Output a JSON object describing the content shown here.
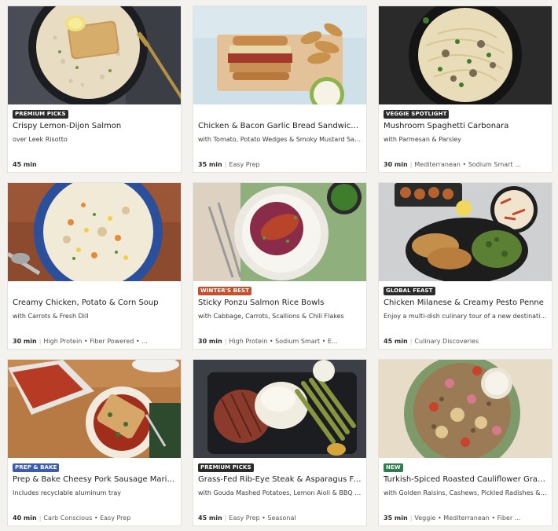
{
  "menu": {
    "cards": [
      {
        "badge": "PREMIUM PICKS",
        "badge_color": "#2b2b2b",
        "title": "Crispy Lemon-Dijon Salmon",
        "subtitle": "over Leek Risotto",
        "time": "45 min",
        "tags": ""
      },
      {
        "badge": "",
        "badge_color": "",
        "title": "Chicken & Bacon Garlic Bread Sandwiches",
        "subtitle": "with Tomato, Potato Wedges & Smoky Mustard Sauce",
        "time": "35 min",
        "tags": "Easy Prep"
      },
      {
        "badge": "VEGGIE SPOTLIGHT",
        "badge_color": "#2b2b2b",
        "title": "Mushroom Spaghetti Carbonara",
        "subtitle": "with Parmesan & Parsley",
        "time": "30 min",
        "tags": "Mediterranean • Sodium Smart ..."
      },
      {
        "badge": "",
        "badge_color": "",
        "title": "Creamy Chicken, Potato & Corn Soup",
        "subtitle": "with Carrots & Fresh Dill",
        "time": "30 min",
        "tags": "High Protein • Fiber Powered • ..."
      },
      {
        "badge": "WINTER'S BEST",
        "badge_color": "#c2522d",
        "title": "Sticky Ponzu Salmon Rice Bowls",
        "subtitle": "with Cabbage, Carrots, Scallions & Chili Flakes",
        "time": "30 min",
        "tags": "High Protein • Sodium Smart • E..."
      },
      {
        "badge": "GLOBAL FEAST",
        "badge_color": "#2b2b2b",
        "title": "Chicken Milanese & Creamy Pesto Penne",
        "subtitle": "Enjoy a multi-dish culinary tour of a new destination!",
        "time": "45 min",
        "tags": "Culinary Discoveries"
      },
      {
        "badge": "PREP & BAKE",
        "badge_color": "#3a5bb0",
        "title": "Prep & Bake Cheesy Pork Sausage Marinara",
        "subtitle": "Includes recyclable aluminum tray",
        "time": "40 min",
        "tags": "Carb Conscious • Easy Prep"
      },
      {
        "badge": "PREMIUM PICKS",
        "badge_color": "#2b2b2b",
        "title": "Grass-Fed Rib-Eye Steak & Asparagus Fries",
        "subtitle": "with Gouda Mashed Potatoes, Lemon Aioli & BBQ Bu...",
        "time": "45 min",
        "tags": "Easy Prep • Seasonal"
      },
      {
        "badge": "NEW",
        "badge_color": "#2f7d4f",
        "title": "Turkish-Spiced Roasted Cauliflower Grain B...",
        "subtitle": "with Golden Raisins, Cashews, Pickled Radishes & G...",
        "time": "35 min",
        "tags": "Veggie • Mediterranean • Fiber ..."
      }
    ]
  }
}
